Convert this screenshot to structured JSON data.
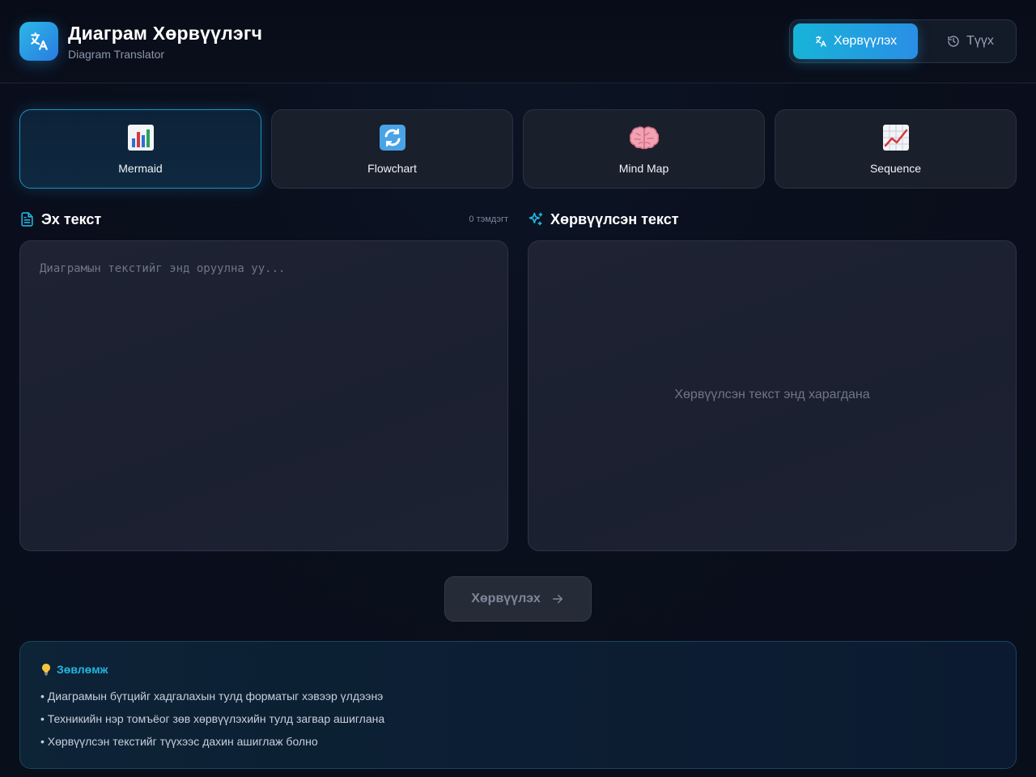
{
  "app": {
    "title": "Диаграм Хөрвүүлэгч",
    "subtitle": "Diagram Translator"
  },
  "nav": {
    "translate_label": "Хөрвүүлэх",
    "history_label": "Түүх"
  },
  "diagram_types": [
    {
      "label": "Mermaid",
      "icon": "bar-chart-icon",
      "selected": true
    },
    {
      "label": "Flowchart",
      "icon": "arrows-cycle-icon",
      "selected": false
    },
    {
      "label": "Mind Map",
      "icon": "brain-icon",
      "selected": false
    },
    {
      "label": "Sequence",
      "icon": "line-chart-icon",
      "selected": false
    }
  ],
  "source": {
    "heading": "Эх текст",
    "char_count": "0 тэмдэгт",
    "placeholder": "Диаграмын текстийг энд оруулна уу...",
    "value": ""
  },
  "output": {
    "heading": "Хөрвүүлсэн текст",
    "placeholder": "Хөрвүүлсэн текст энд харагдана"
  },
  "action": {
    "translate_label": "Хөрвүүлэх"
  },
  "tips": {
    "title": "Зөвлөмж",
    "items": [
      "• Диаграмын бүтцийг хадгалахын тулд форматыг хэвээр үлдээнэ",
      "• Техникийн нэр томъёог зөв хөрвүүлэхийн тулд загвар ашиглана",
      "• Хөрвүүлсэн текстийг түүхээс дахин ашиглаж болно"
    ]
  },
  "colors": {
    "accent": "#1fb0dc",
    "accent_blue": "#2a8ee6",
    "background": "#0a0f1c",
    "panel": "#1c2131"
  }
}
